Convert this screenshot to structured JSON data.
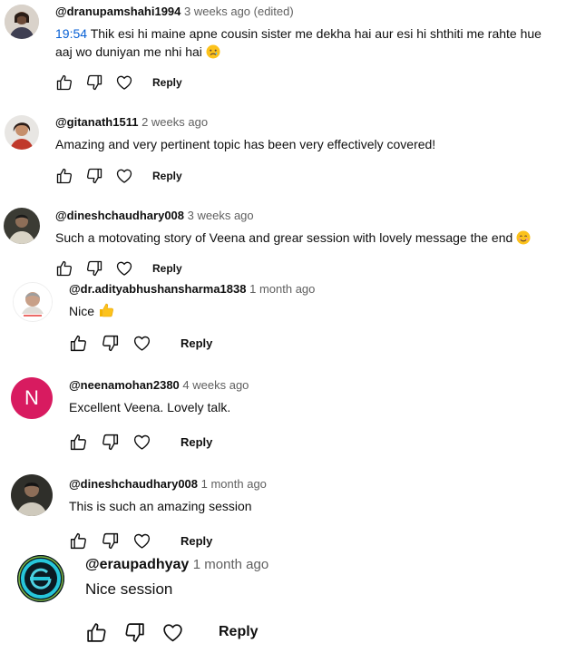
{
  "comments": [
    {
      "author": "@dranupamshahi1994",
      "time": "3 weeks ago (edited)",
      "timestamp_link": "19:54",
      "text": "Thik esi hi maine apne cousin sister me dekha hai aur esi hi shthiti me  rahte hue aaj wo  duniyan me nhi hai",
      "reply_label": "Reply"
    },
    {
      "author": "@gitanath1511",
      "time": "2 weeks ago",
      "text": "Amazing and very pertinent topic has been very effectively covered!",
      "reply_label": "Reply"
    },
    {
      "author": "@dineshchaudhary008",
      "time": "3 weeks ago",
      "text": "Such a motovating story of Veena and grear session with lovely message the end",
      "reply_label": "Reply"
    },
    {
      "author": "@dr.adityabhushansharma1838",
      "time": "1 month ago",
      "text": "Nice",
      "reply_label": "Reply"
    },
    {
      "author": "@neenamohan2380",
      "time": "4 weeks ago",
      "avatar_letter": "N",
      "text": "Excellent Veena. Lovely talk.",
      "reply_label": "Reply"
    },
    {
      "author": "@dineshchaudhary008",
      "time": "1 month ago",
      "text": "This is such an amazing session",
      "reply_label": "Reply"
    },
    {
      "author": "@eraupadhyay",
      "time": "1 month ago",
      "text": "Nice session",
      "reply_label": "Reply"
    }
  ],
  "colors": {
    "link": "#065fd4",
    "secondary_text": "#606060",
    "avatar_n": "#d81b60"
  }
}
